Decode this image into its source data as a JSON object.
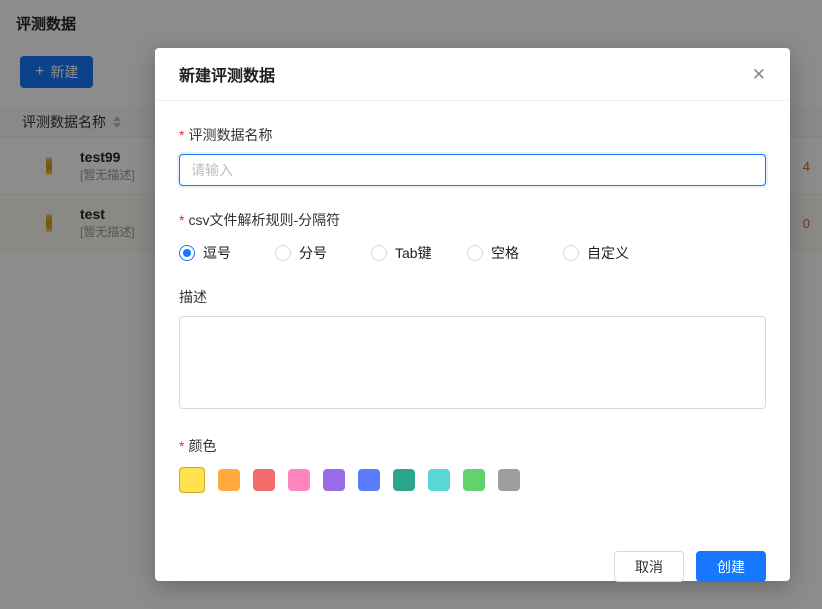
{
  "page": {
    "title": "评测数据",
    "new_button_label": "新建",
    "table": {
      "name_header": "评测数据名称",
      "rows": [
        {
          "name": "test99",
          "desc": "[暂无描述]",
          "count": "4"
        },
        {
          "name": "test",
          "desc": "[暂无描述]",
          "count": "0"
        }
      ]
    }
  },
  "modal": {
    "title": "新建评测数据",
    "close_icon": "✕",
    "accent_color": "#1677ff",
    "required_mark": "*",
    "name_field": {
      "label": "评测数据名称",
      "required": "*",
      "value": "",
      "placeholder": "请输入"
    },
    "delimiter_field": {
      "label": "csv文件解析规则-分隔符",
      "required": "*",
      "options": [
        {
          "label": "逗号",
          "selected": true
        },
        {
          "label": "分号",
          "selected": false
        },
        {
          "label": "Tab键",
          "selected": false
        },
        {
          "label": "空格",
          "selected": false
        },
        {
          "label": "自定义",
          "selected": false
        }
      ]
    },
    "description_field": {
      "label": "描述",
      "value": ""
    },
    "color_field": {
      "label": "颜色",
      "required": "*",
      "colors": [
        {
          "hex": "#ffe14d",
          "selected": true
        },
        {
          "hex": "#ffa940",
          "selected": false
        },
        {
          "hex": "#f56c6c",
          "selected": false
        },
        {
          "hex": "#ff85c0",
          "selected": false
        },
        {
          "hex": "#9b6ce8",
          "selected": false
        },
        {
          "hex": "#5b7cfa",
          "selected": false
        },
        {
          "hex": "#2ca58d",
          "selected": false
        },
        {
          "hex": "#5bd6d6",
          "selected": false
        },
        {
          "hex": "#62d26f",
          "selected": false
        },
        {
          "hex": "#9e9e9e",
          "selected": false
        }
      ]
    },
    "footer": {
      "cancel_label": "取消",
      "create_label": "创建"
    }
  }
}
